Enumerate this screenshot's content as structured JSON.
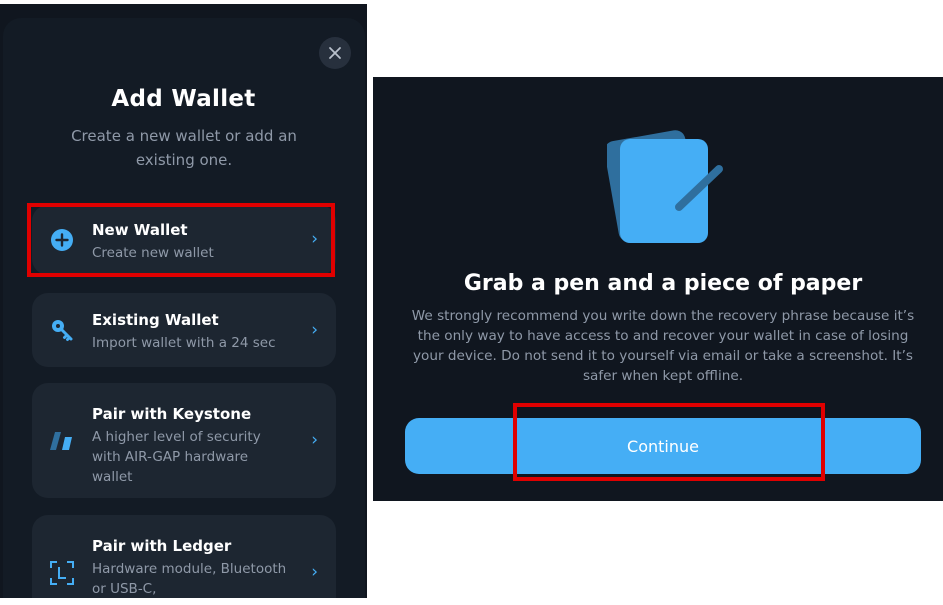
{
  "add_wallet": {
    "title": "Add Wallet",
    "subtitle": "Create a new wallet or add an existing one.",
    "options": [
      {
        "icon": "plus-circle-icon",
        "title": "New Wallet",
        "description": "Create new wallet"
      },
      {
        "icon": "key-icon",
        "title": "Existing Wallet",
        "description": "Import wallet with a 24 sec"
      },
      {
        "icon": "keystone-icon",
        "title": "Pair with Keystone",
        "description": "A higher level of security with AIR-GAP hardware wallet"
      },
      {
        "icon": "ledger-icon",
        "title": "Pair with Ledger",
        "description": "Hardware module, Bluetooth or USB-C,"
      }
    ]
  },
  "backup_intro": {
    "title": "Grab a pen and a piece of paper",
    "body": "We strongly recommend you write down the recovery phrase because it’s the only way to have access to and recover your wallet in case of losing your device. Do not send it to yourself via email or take a screenshot. It’s safer when kept offline.",
    "continue_label": "Continue"
  },
  "colors": {
    "accent": "#45aef5",
    "background": "#10161f",
    "card": "#1d2631",
    "highlight": "#e00000"
  }
}
